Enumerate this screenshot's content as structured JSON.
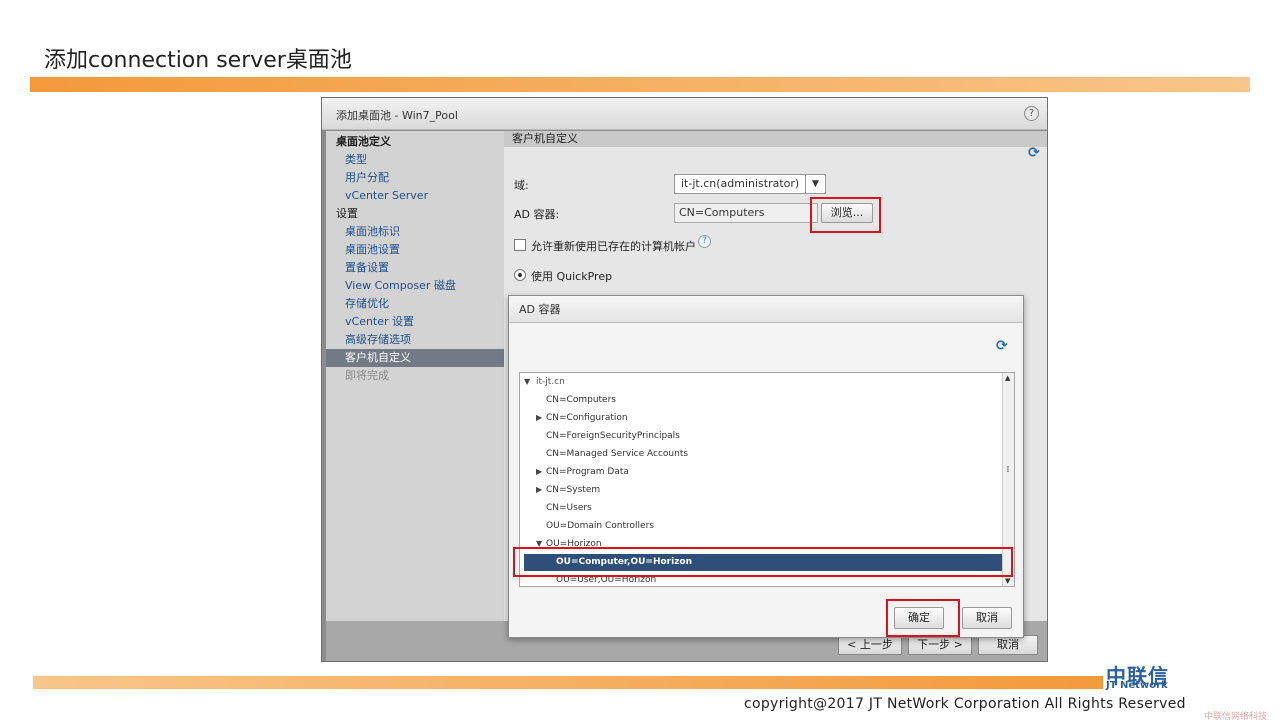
{
  "slide": {
    "title": "添加connection server桌面池",
    "copyright": "copyright@2017  JT NetWork Corporation All Rights Reserved",
    "logo_cn": "中联信",
    "logo_en": "JT Network",
    "watermark": "中联信网络科技"
  },
  "window": {
    "title": "添加桌面池 - Win7_Pool",
    "help": "?"
  },
  "sidebar": {
    "section1": "桌面池定义",
    "section1_items": [
      "类型",
      "用户分配",
      "vCenter Server"
    ],
    "section2": "设置",
    "section2_items": [
      "桌面池标识",
      "桌面池设置",
      "置备设置",
      "View Composer 磁盘",
      "存储优化",
      "vCenter 设置",
      "高级存储选项",
      "客户机自定义",
      "即将完成"
    ]
  },
  "pane": {
    "header": "客户机自定义",
    "domain_label": "域:",
    "domain_value": "it-jt.cn(administrator)",
    "ad_label": "AD 容器:",
    "ad_value": "CN=Computers",
    "browse_label": "浏览...",
    "reuse_label": "允许重新使用已存在的计算机帐户",
    "quickprep_label": "使用 QuickPrep"
  },
  "footer_nav": {
    "prev": "< 上一步",
    "next": "下一步 >",
    "cancel": "取消"
  },
  "dialog": {
    "title": "AD 容器",
    "tree": {
      "root": "it-jt.cn",
      "items": [
        "CN=Computers",
        "CN=Configuration",
        "CN=ForeignSecurityPrincipals",
        "CN=Managed Service Accounts",
        "CN=Program Data",
        "CN=System",
        "CN=Users",
        "OU=Domain Controllers",
        "OU=Horizon"
      ],
      "selected": "OU=Computer,OU=Horizon",
      "after_selected": "OU=User,OU=Horizon"
    },
    "ok": "确定",
    "cancel": "取消"
  },
  "colors": {
    "accent_orange": "#f39a3a",
    "highlight_red": "#d9121b",
    "selection_blue": "#2e4f79",
    "link_blue": "#1d4f8e"
  }
}
